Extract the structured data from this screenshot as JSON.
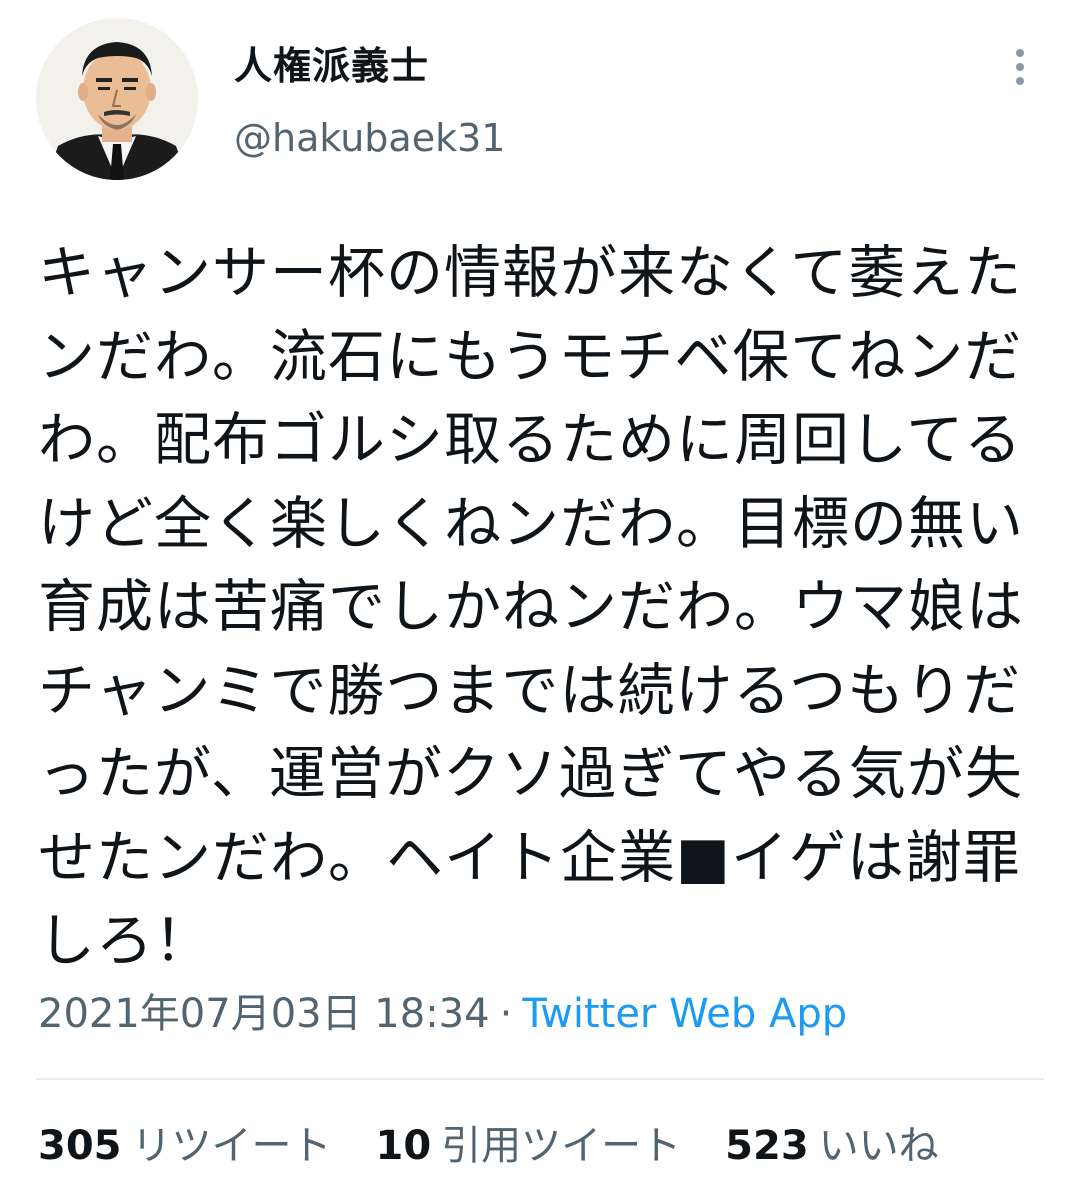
{
  "user": {
    "display_name": "人権派義士",
    "handle": "@hakubaek31"
  },
  "tweet": {
    "text": "キャンサー杯の情報が来なくて萎えたンだわ。流石にもうモチベ保てねンだわ。配布ゴルシ取るために周回してるけど全く楽しくねンだわ。目標の無い育成は苦痛でしかねンだわ。ウマ娘はチャンミで勝つまでは続けるつもりだったが、運営がクソ過ぎてやる気が失せたンだわ。ヘイト企業■イゲは謝罪しろ！",
    "timestamp": "2021年07月03日 18:34",
    "separator": "·",
    "source": "Twitter Web App"
  },
  "stats": {
    "retweets_count": "305",
    "retweets_label": "リツイート",
    "quotes_count": "10",
    "quotes_label": "引用ツイート",
    "likes_count": "523",
    "likes_label": "いいね"
  },
  "colors": {
    "text": "#0f1419",
    "secondary": "#536471",
    "link": "#1d9bf0",
    "divider": "#e6ecf0"
  },
  "icons": {
    "more": "more-vertical-icon",
    "avatar": "avatar-illustration"
  }
}
